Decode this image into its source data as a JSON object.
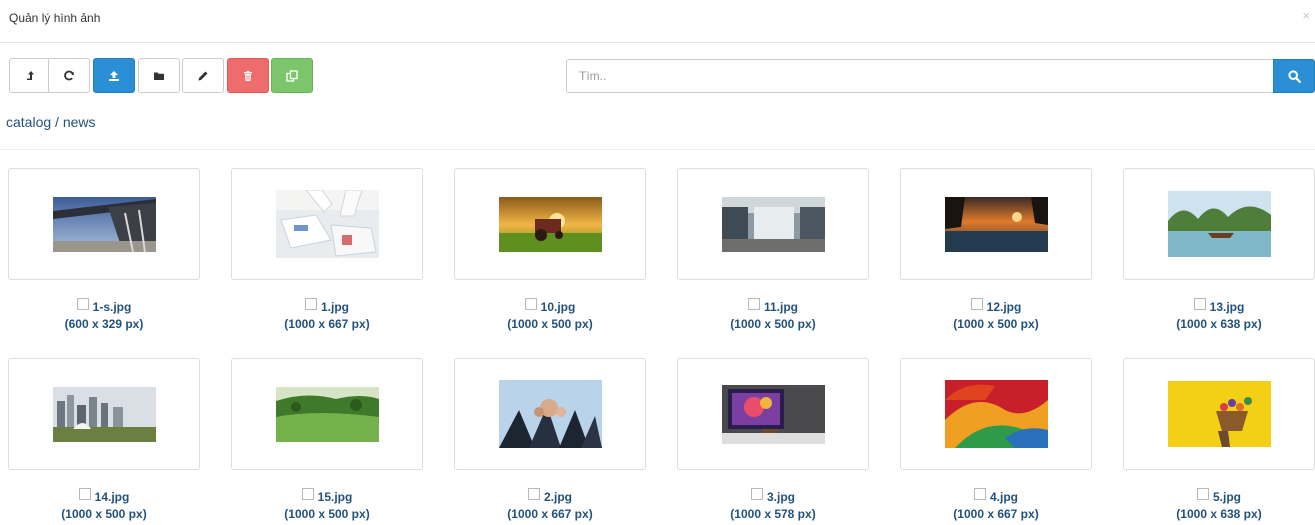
{
  "header": {
    "title": "Quản lý hình ảnh",
    "close": "×"
  },
  "toolbar": {
    "buttons": [
      {
        "name": "parent-folder-button",
        "icon": "level-up-icon",
        "style": "default"
      },
      {
        "name": "refresh-button",
        "icon": "refresh-icon",
        "style": "default"
      },
      {
        "name": "upload-button",
        "icon": "upload-icon",
        "style": "primary"
      },
      {
        "name": "new-folder-button",
        "icon": "folder-icon",
        "style": "default"
      },
      {
        "name": "rename-button",
        "icon": "pencil-icon",
        "style": "default"
      },
      {
        "name": "delete-button",
        "icon": "trash-icon",
        "style": "danger"
      },
      {
        "name": "copy-button",
        "icon": "copy-icon",
        "style": "success"
      }
    ]
  },
  "search": {
    "placeholder": "Tìm..",
    "value": ""
  },
  "breadcrumb": {
    "items": [
      "catalog",
      "news"
    ],
    "separator": "/"
  },
  "colors": {
    "primary": "#2a8fd4",
    "danger": "#ef6c6c",
    "success": "#7bc66a",
    "link": "#23527c"
  },
  "images": [
    {
      "name": "1-s.jpg",
      "size": "(600 x 329 px)"
    },
    {
      "name": "1.jpg",
      "size": "(1000 x 667 px)"
    },
    {
      "name": "10.jpg",
      "size": "(1000 x 500 px)"
    },
    {
      "name": "11.jpg",
      "size": "(1000 x 500 px)"
    },
    {
      "name": "12.jpg",
      "size": "(1000 x 500 px)"
    },
    {
      "name": "13.jpg",
      "size": "(1000 x 638 px)"
    },
    {
      "name": "14.jpg",
      "size": "(1000 x 500 px)"
    },
    {
      "name": "15.jpg",
      "size": "(1000 x 500 px)"
    },
    {
      "name": "2.jpg",
      "size": "(1000 x 667 px)"
    },
    {
      "name": "3.jpg",
      "size": "(1000 x 578 px)"
    },
    {
      "name": "4.jpg",
      "size": "(1000 x 667 px)"
    },
    {
      "name": "5.jpg",
      "size": "(1000 x 638 px)"
    }
  ]
}
